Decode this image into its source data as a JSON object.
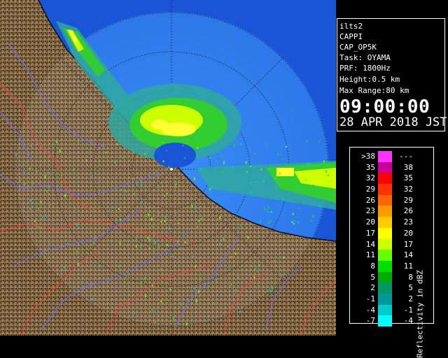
{
  "info": {
    "radar_id": "ilts2",
    "product": "CAPPI",
    "operation": "CAP_OP5K",
    "task": "Task: OYAMA",
    "prf": "PRF: 1800Hz",
    "height": "Height:0.5 km",
    "max_range": "Max Range:80 km",
    "time": "09:00:00",
    "date": "28 APR 2018 JST"
  },
  "legend": {
    "title": "Reflectivity in dBZ",
    "rows": [
      {
        "low": ">38",
        "high": "---",
        "color": "#ff33ff"
      },
      {
        "low": "35",
        "high": "38",
        "color": "#cc0099"
      },
      {
        "low": "32",
        "high": "35",
        "color": "#ff0000"
      },
      {
        "low": "29",
        "high": "32",
        "color": "#ff3300"
      },
      {
        "low": "26",
        "high": "29",
        "color": "#ff6600"
      },
      {
        "low": "23",
        "high": "26",
        "color": "#ff9900"
      },
      {
        "low": "20",
        "high": "23",
        "color": "#ffcc00"
      },
      {
        "low": "17",
        "high": "20",
        "color": "#ffff00"
      },
      {
        "low": "14",
        "high": "17",
        "color": "#ccff00"
      },
      {
        "low": "11",
        "high": "14",
        "color": "#66ff00"
      },
      {
        "low": "8",
        "high": "11",
        "color": "#00dd00"
      },
      {
        "low": "5",
        "high": "8",
        "color": "#00aa00"
      },
      {
        "low": "2",
        "high": "5",
        "color": "#009966"
      },
      {
        "low": "-1",
        "high": "2",
        "color": "#009999"
      },
      {
        "low": "-4",
        "high": "-1",
        "color": "#00cccc"
      },
      {
        "low": "-7",
        "high": "-4",
        "color": "#00ffff"
      }
    ]
  },
  "colors": {
    "sea": "#1a55d8",
    "sea_coverage": "#2f7ff0",
    "land": "#8a6e48",
    "land_dark": "#3b2c1e",
    "rivers": "#6a6aff",
    "boundaries": "#ff3a3a",
    "echo_weak": "#2fa8a0",
    "echo_mid": "#44cc44",
    "echo_strong": "#ffff33"
  }
}
